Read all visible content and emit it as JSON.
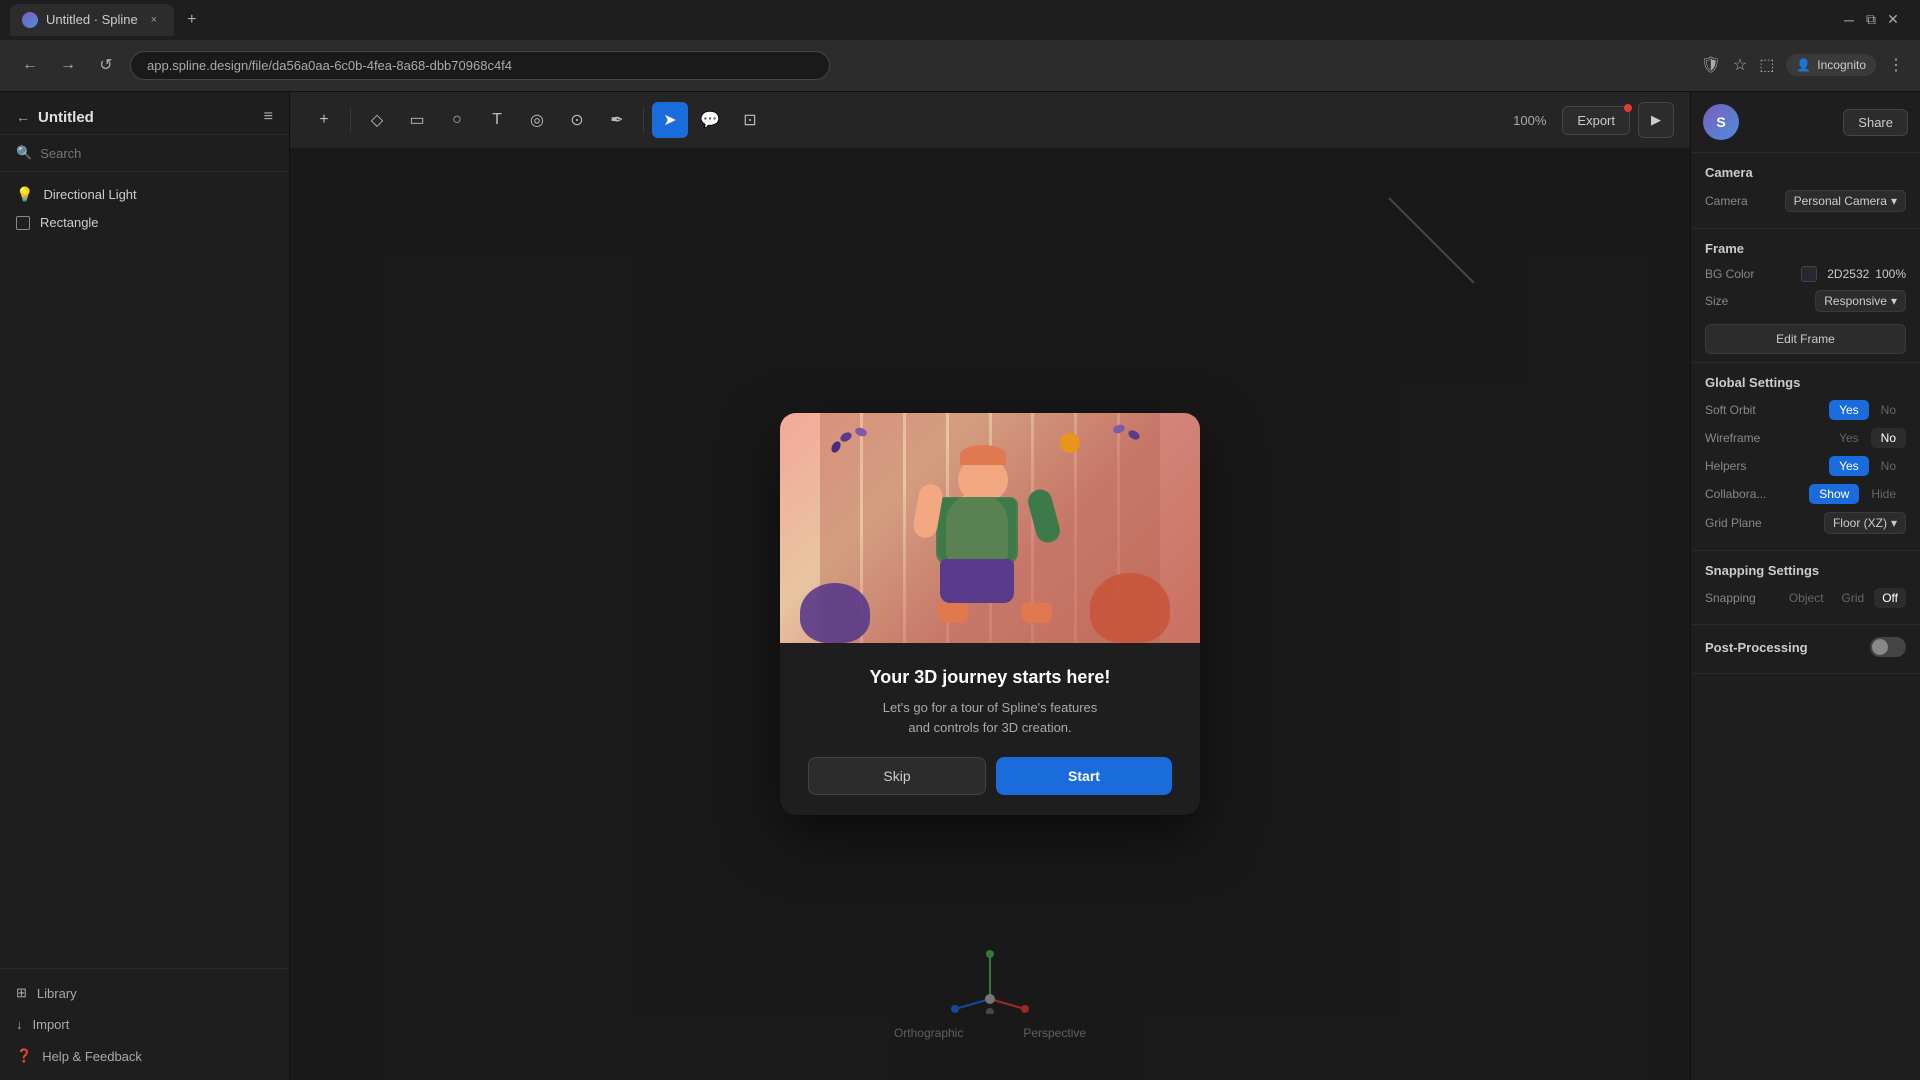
{
  "browser": {
    "tab_title": "Untitled · Spline",
    "tab_close": "×",
    "new_tab": "+",
    "url": "app.spline.design/file/da56a0aa-6c0b-4fea-8a68-dbb70968c4f4",
    "incognito_label": "Incognito",
    "nav_back": "←",
    "nav_forward": "→",
    "nav_refresh": "↺"
  },
  "sidebar": {
    "title": "Untitled",
    "back_icon": "←",
    "menu_icon": "≡",
    "search_placeholder": "Search",
    "items": [
      {
        "label": "Directional Light",
        "type": "light"
      },
      {
        "label": "Rectangle",
        "type": "rect"
      }
    ],
    "footer": [
      {
        "label": "Library",
        "icon": "⊞"
      },
      {
        "label": "Import",
        "icon": "↓"
      },
      {
        "label": "Help & Feedback",
        "icon": "?"
      }
    ]
  },
  "toolbar": {
    "tools": [
      {
        "id": "add",
        "icon": "+",
        "active": false
      },
      {
        "id": "select-multi",
        "icon": "◇",
        "active": false
      },
      {
        "id": "rect",
        "icon": "▭",
        "active": false
      },
      {
        "id": "circle",
        "icon": "○",
        "active": false
      },
      {
        "id": "text",
        "icon": "T",
        "active": false
      },
      {
        "id": "sphere",
        "icon": "◎",
        "active": false
      },
      {
        "id": "blob",
        "icon": "⊙",
        "active": false
      },
      {
        "id": "pen",
        "icon": "✒",
        "active": false
      },
      {
        "id": "pointer",
        "icon": "⬆",
        "active": true
      },
      {
        "id": "comment",
        "icon": "💬",
        "active": false
      },
      {
        "id": "crop",
        "icon": "⊡",
        "active": false
      }
    ],
    "zoom": "100%",
    "export_label": "Export",
    "play_icon": "▶"
  },
  "modal": {
    "title": "Your 3D journey starts here!",
    "description": "Let's go for a tour of Spline's features\nand controls for 3D creation.",
    "skip_label": "Skip",
    "start_label": "Start"
  },
  "right_panel": {
    "avatar_letter": "S",
    "share_label": "Share",
    "camera": {
      "section_title": "Camera",
      "camera_label": "Camera",
      "camera_value": "Personal Camera",
      "chevron": "▾"
    },
    "frame": {
      "section_title": "Frame",
      "bg_color_label": "BG Color",
      "bg_color_hex": "2D2532",
      "bg_color_opacity": "100%",
      "size_label": "Size",
      "size_value": "Responsive",
      "size_chevron": "▾",
      "edit_frame_label": "Edit Frame"
    },
    "global_settings": {
      "section_title": "Global Settings",
      "soft_orbit_label": "Soft Orbit",
      "soft_orbit_yes": "Yes",
      "soft_orbit_no": "No",
      "wireframe_label": "Wireframe",
      "wireframe_yes": "Yes",
      "wireframe_no": "No",
      "helpers_label": "Helpers",
      "helpers_yes": "Yes",
      "helpers_no": "No",
      "collaborators_label": "Collabora...",
      "collab_show": "Show",
      "collab_hide": "Hide",
      "grid_plane_label": "Grid Plane",
      "grid_plane_value": "Floor (XZ)",
      "grid_chevron": "▾"
    },
    "snapping": {
      "section_title": "Snapping Settings",
      "snapping_label": "Snapping",
      "object_label": "Object",
      "grid_label": "Grid",
      "off_label": "Off"
    },
    "post_processing": {
      "section_title": "Post-Processing"
    }
  },
  "viewport": {
    "view_labels": {
      "orthographic": "Orthographic",
      "perspective": "Perspective"
    }
  }
}
